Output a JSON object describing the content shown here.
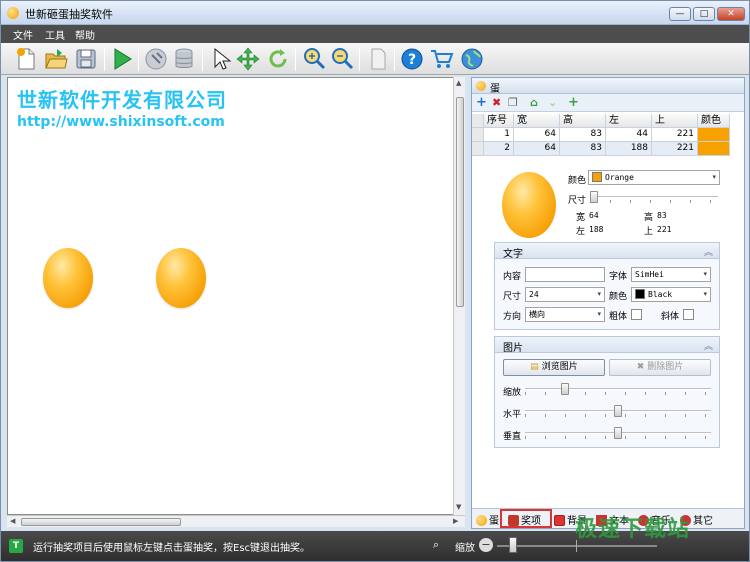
{
  "window": {
    "title": "世新砸蛋抽奖软件",
    "btn_min": "—",
    "btn_max": "□",
    "btn_close": "✕"
  },
  "menu": {
    "file": "文件",
    "tools": "工具",
    "help": "帮助"
  },
  "toolbar": {
    "items": [
      "new-file-icon",
      "open-folder-icon",
      "save-icon",
      "play-icon",
      "hammer-icon",
      "database-icon",
      "cursor-icon",
      "move-icon",
      "rotate-icon",
      "zoom-in-icon",
      "zoom-out-icon",
      "page-icon",
      "help-icon",
      "cart-icon",
      "globe-icon"
    ]
  },
  "canvas": {
    "title": "世新软件开发有限公司",
    "url": "http://www.shixinsoft.com",
    "eggs": 2,
    "egg_color": "#f7a100",
    "text_color": "#27c3f5"
  },
  "panel": {
    "title": "蛋",
    "tools": {
      "add": "+",
      "delete": "✖",
      "copy": "❐",
      "up": "⌂",
      "down": "⌄",
      "add_green": "+"
    },
    "grid": {
      "headers": [
        "",
        "序号",
        "宽",
        "高",
        "左",
        "上",
        "颜色"
      ],
      "rows": [
        {
          "index": "1",
          "width": "64",
          "height": "83",
          "left": "44",
          "top": "221"
        },
        {
          "index": "2",
          "width": "64",
          "height": "83",
          "left": "188",
          "top": "221"
        }
      ]
    },
    "props": {
      "color_label": "颜色",
      "color_value": "Orange",
      "size_label": "尺寸",
      "width_label": "宽",
      "width_value": "64",
      "height_label": "高",
      "height_value": "83",
      "left_label": "左",
      "left_value": "188",
      "top_label": "上",
      "top_value": "221",
      "size_slider": 0.02
    },
    "text_group": {
      "title": "文字",
      "content_label": "内容",
      "content_value": "",
      "font_label": "字体",
      "font_value": "SimHei",
      "size_label": "尺寸",
      "size_value": "24",
      "color_label": "颜色",
      "color_value": "Black",
      "direction_label": "方向",
      "direction_value": "横向",
      "bold_label": "粗体",
      "italic_label": "斜体",
      "collapse": "︽"
    },
    "image_group": {
      "title": "图片",
      "browse_label": "浏览图片",
      "delete_label": "删除图片",
      "scale_label": "缩放",
      "scale_value": 0.2,
      "horizontal_label": "水平",
      "horizontal_value": 0.5,
      "vertical_label": "垂直",
      "vertical_value": 0.5,
      "collapse": "︽"
    },
    "tabs": {
      "egg": "蛋",
      "prize": "奖项",
      "background": "背景",
      "text": "文本",
      "music": "音乐",
      "other": "其它"
    }
  },
  "status": {
    "icon": "T",
    "text": "运行抽奖项目后使用鼠标左键点击蛋抽奖，按Esc键退出抽奖。",
    "zoom_label": "缩放",
    "zoom_minus": "−",
    "zoom_value": 0.08
  },
  "watermark": "极速下载站"
}
